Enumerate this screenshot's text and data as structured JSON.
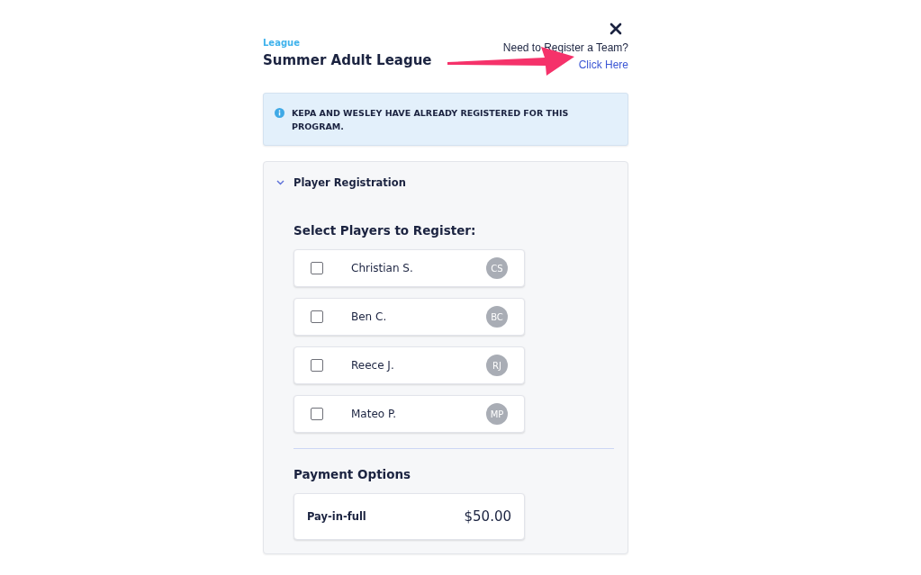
{
  "header": {
    "eyebrow": "League",
    "title": "Summer Adult League",
    "prompt": "Need to Register a Team?",
    "link": "Click Here"
  },
  "notice": {
    "text": "KEPA AND WESLEY HAVE ALREADY REGISTERED FOR THIS PROGRAM."
  },
  "panel": {
    "title": "Player Registration",
    "expanded": true,
    "players_heading": "Select Players to Register:",
    "players": [
      {
        "name": "Christian S.",
        "initials": "CS",
        "checked": false
      },
      {
        "name": "Ben C.",
        "initials": "BC",
        "checked": false
      },
      {
        "name": "Reece J.",
        "initials": "RJ",
        "checked": false
      },
      {
        "name": "Mateo P.",
        "initials": "MP",
        "checked": false
      }
    ],
    "payment_heading": "Payment Options",
    "payment_options": [
      {
        "label": "Pay-in-full",
        "price": "$50.00"
      }
    ]
  }
}
